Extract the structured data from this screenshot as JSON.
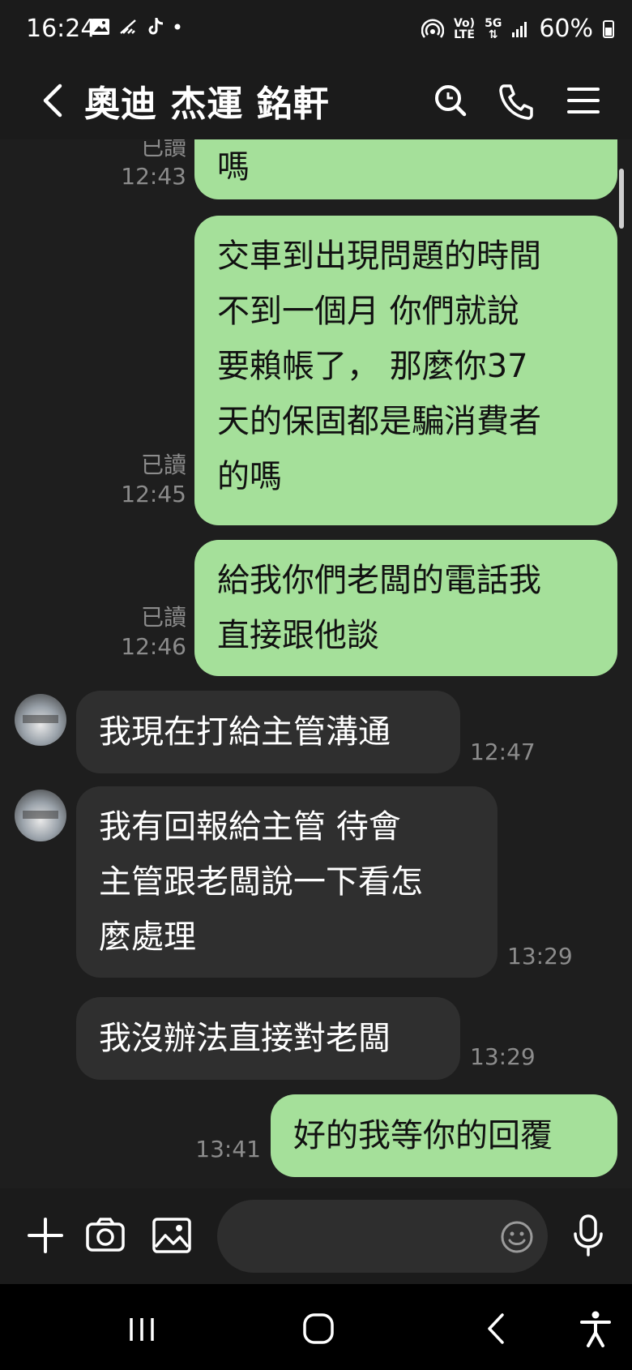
{
  "status_bar": {
    "time": "16:24",
    "network_label_top": "Vo)",
    "network_label_bottom": "LTE",
    "five_g": "5G",
    "battery": "60%"
  },
  "header": {
    "title": "奧迪 杰運 銘軒"
  },
  "messages": [
    {
      "dir": "out",
      "text": "嗎",
      "read": "已讀",
      "time": "12:43"
    },
    {
      "dir": "out",
      "text": "交車到出現問題的時間\n不到一個月 你們就說\n要賴帳了， 那麼你37\n天的保固都是騙消費者\n的嗎",
      "read": "已讀",
      "time": "12:45"
    },
    {
      "dir": "out",
      "text": "給我你們老闆的電話我\n直接跟他談",
      "read": "已讀",
      "time": "12:46"
    },
    {
      "dir": "in",
      "text": "我現在打給主管溝通",
      "time": "12:47"
    },
    {
      "dir": "in",
      "text": "我有回報給主管 待會\n主管跟老闆說一下看怎\n麼處理",
      "time": "13:29"
    },
    {
      "dir": "in",
      "text": "我沒辦法直接對老闆",
      "time": "13:29"
    },
    {
      "dir": "out",
      "text": "好的我等你的回覆",
      "time": "13:41"
    }
  ],
  "input_bar": {
    "placeholder": ""
  },
  "colors": {
    "outgoing_bubble": "#a5e09a",
    "incoming_bubble": "#2f2f2f",
    "background": "#1e1e1e",
    "meta_text": "#8c8c8c"
  }
}
